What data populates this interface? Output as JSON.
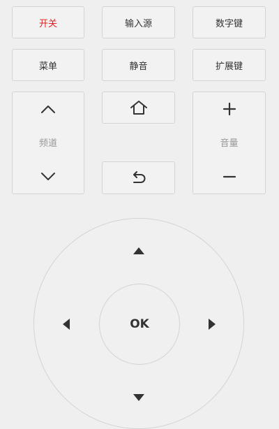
{
  "colors": {
    "background": "#efefef",
    "button_border": "#d3d3d3",
    "power_text": "#e02020",
    "label_gray": "#999999",
    "icon_dark": "#333333"
  },
  "top_row": {
    "power_label": "开关",
    "input_source_label": "输入源",
    "number_keys_label": "数字键"
  },
  "second_row": {
    "menu_label": "菜单",
    "mute_label": "静音",
    "extend_keys_label": "扩展键"
  },
  "channel": {
    "label": "频道",
    "up_icon": "chevron-up-icon",
    "down_icon": "chevron-down-icon"
  },
  "center_buttons": {
    "home_icon": "home-icon",
    "back_icon": "back-icon"
  },
  "volume": {
    "label": "音量",
    "plus_icon": "plus-icon",
    "minus_icon": "minus-icon"
  },
  "dpad": {
    "ok_label": "OK",
    "up_icon": "triangle-up-icon",
    "down_icon": "triangle-down-icon",
    "left_icon": "triangle-left-icon",
    "right_icon": "triangle-right-icon"
  }
}
